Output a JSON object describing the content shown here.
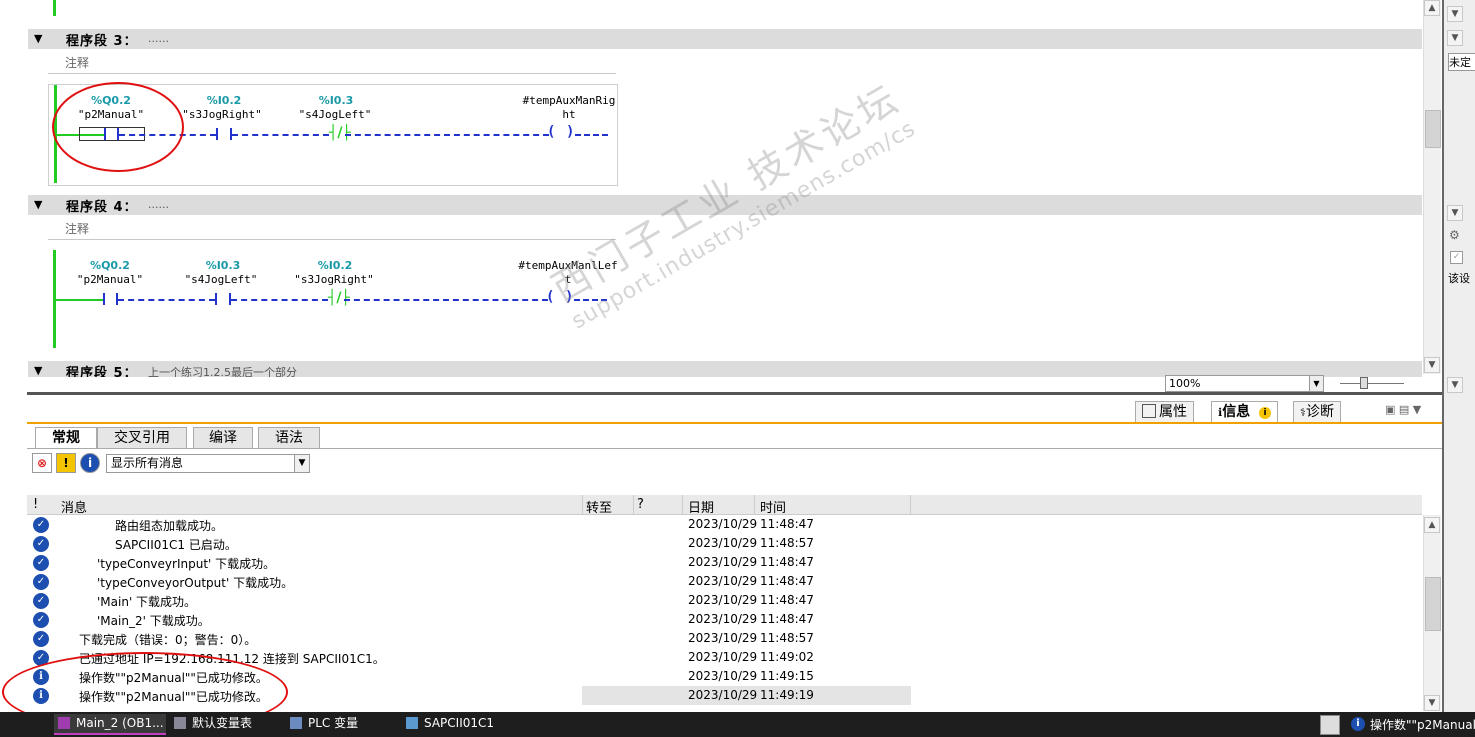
{
  "editor": {
    "networks": [
      {
        "title": "程序段 3：",
        "comment_hint": "......",
        "comment_label": "注释",
        "contacts": [
          {
            "addr": "%Q0.2",
            "sym": "\"p2Manual\""
          },
          {
            "addr": "%I0.2",
            "sym": "\"s3JogRight\""
          },
          {
            "addr": "%I0.3",
            "sym": "\"s4JogLeft\""
          }
        ],
        "coil_line1": "#tempAuxManRig",
        "coil_line2": "ht"
      },
      {
        "title": "程序段 4：",
        "comment_hint": "......",
        "comment_label": "注释",
        "contacts": [
          {
            "addr": "%Q0.2",
            "sym": "\"p2Manual\""
          },
          {
            "addr": "%I0.3",
            "sym": "\"s4JogLeft\""
          },
          {
            "addr": "%I0.2",
            "sym": "\"s3JogRight\""
          }
        ],
        "coil_line1": "#tempAuxManlLef",
        "coil_line2": "t"
      },
      {
        "title": "程序段 5：",
        "comment_hint": "上一个练习1.2.5最后一个部分"
      }
    ],
    "zoom": "100%"
  },
  "panel_tabs": {
    "properties": "属性",
    "info": "信息",
    "diagnostics": "诊断"
  },
  "subtabs": [
    "常规",
    "交叉引用",
    "编译",
    "语法"
  ],
  "filter": {
    "value": "显示所有消息"
  },
  "table": {
    "headers": {
      "flag": "!",
      "message": "消息",
      "goto": "转至",
      "q": "?",
      "date": "日期",
      "time": "时间"
    },
    "rows": [
      {
        "icon": "ok",
        "indent": 2,
        "message": "路由组态加载成功。",
        "date": "2023/10/29",
        "time": "11:48:47"
      },
      {
        "icon": "ok",
        "indent": 2,
        "message": "SAPCII01C1 已启动。",
        "date": "2023/10/29",
        "time": "11:48:57"
      },
      {
        "icon": "ok",
        "indent": 1,
        "message": "'typeConveyrInput' 下载成功。",
        "date": "2023/10/29",
        "time": "11:48:47"
      },
      {
        "icon": "ok",
        "indent": 1,
        "message": "'typeConveyorOutput' 下载成功。",
        "date": "2023/10/29",
        "time": "11:48:47"
      },
      {
        "icon": "ok",
        "indent": 1,
        "message": "'Main' 下载成功。",
        "date": "2023/10/29",
        "time": "11:48:47"
      },
      {
        "icon": "ok",
        "indent": 1,
        "message": "'Main_2' 下载成功。",
        "date": "2023/10/29",
        "time": "11:48:47"
      },
      {
        "icon": "ok",
        "indent": 0,
        "message": "下载完成（错误：0；警告：0）。",
        "date": "2023/10/29",
        "time": "11:48:57"
      },
      {
        "icon": "ok",
        "indent": 0,
        "message": "已通过地址 IP=192.168.111.12 连接到 SAPCII01C1。",
        "date": "2023/10/29",
        "time": "11:49:02"
      },
      {
        "icon": "info",
        "indent": 0,
        "message": "操作数\"\"p2Manual\"\"已成功修改。",
        "date": "2023/10/29",
        "time": "11:49:15"
      },
      {
        "icon": "info",
        "indent": 0,
        "message": "操作数\"\"p2Manual\"\"已成功修改。",
        "date": "2023/10/29",
        "time": "11:49:19"
      }
    ]
  },
  "watermark": {
    "line1": "西门子工业 技术论坛",
    "line2": "support.industry.siemens.com/cs"
  },
  "right_panel": {
    "text1": "未定",
    "text2": "该设"
  },
  "taskbar": {
    "items": [
      "Main_2 (OB1...",
      "默认变量表",
      "PLC 变量",
      "SAPCII01C1"
    ],
    "status": "操作数\"\"p2Manual\""
  },
  "colors": {
    "accent": "#f0a000",
    "address": "#1a9aa8",
    "wire": "#2233cc",
    "rail": "#22cc22",
    "annotation": "#e01010"
  }
}
